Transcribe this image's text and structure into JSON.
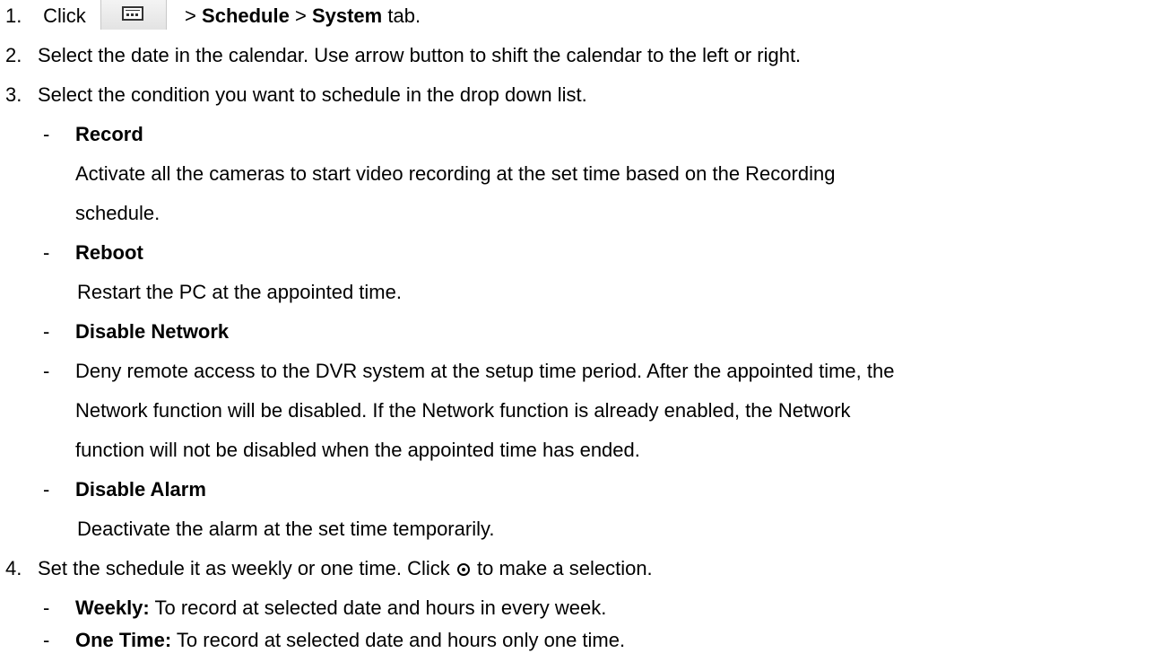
{
  "steps": [
    {
      "num": "1.",
      "before": "Click",
      "gt1": ">",
      "schedule": "Schedule",
      "gt2": ">",
      "system": "System",
      "after": "tab."
    },
    {
      "num": "2.",
      "text": "Select the date in the calendar. Use arrow button to shift the calendar to the left or right."
    },
    {
      "num": "3.",
      "text": "Select the condition you want to schedule in the drop down list."
    },
    {
      "num": "4.",
      "before": "Set the schedule it as weekly or one time. Click",
      "after": "to make a selection."
    }
  ],
  "conditions": {
    "record": {
      "title": "Record",
      "desc": [
        "Activate all the cameras to start video recording at the set time based on the Recording",
        "schedule."
      ]
    },
    "reboot": {
      "title": "Reboot",
      "desc": [
        "Restart the PC at the appointed time."
      ]
    },
    "network": {
      "title": "Disable Network",
      "desc": [
        "Deny remote access to the DVR system at the setup time period. After the appointed time, the",
        "Network function will be disabled. If the Network function is already enabled, the Network",
        "function will not be disabled when the appointed time has ended."
      ]
    },
    "alarm": {
      "title": "Disable Alarm",
      "desc": [
        "Deactivate the alarm at the set time temporarily."
      ]
    }
  },
  "options": {
    "weekly": {
      "label": "Weekly:",
      "desc": "To record at selected date and hours in every week."
    },
    "onetime": {
      "label": "One Time:",
      "desc": "To record at selected date and hours only one time."
    }
  },
  "dash": "-",
  "icons": {
    "toolbar": "calendar-icon",
    "radio": "radio-selected-icon"
  }
}
